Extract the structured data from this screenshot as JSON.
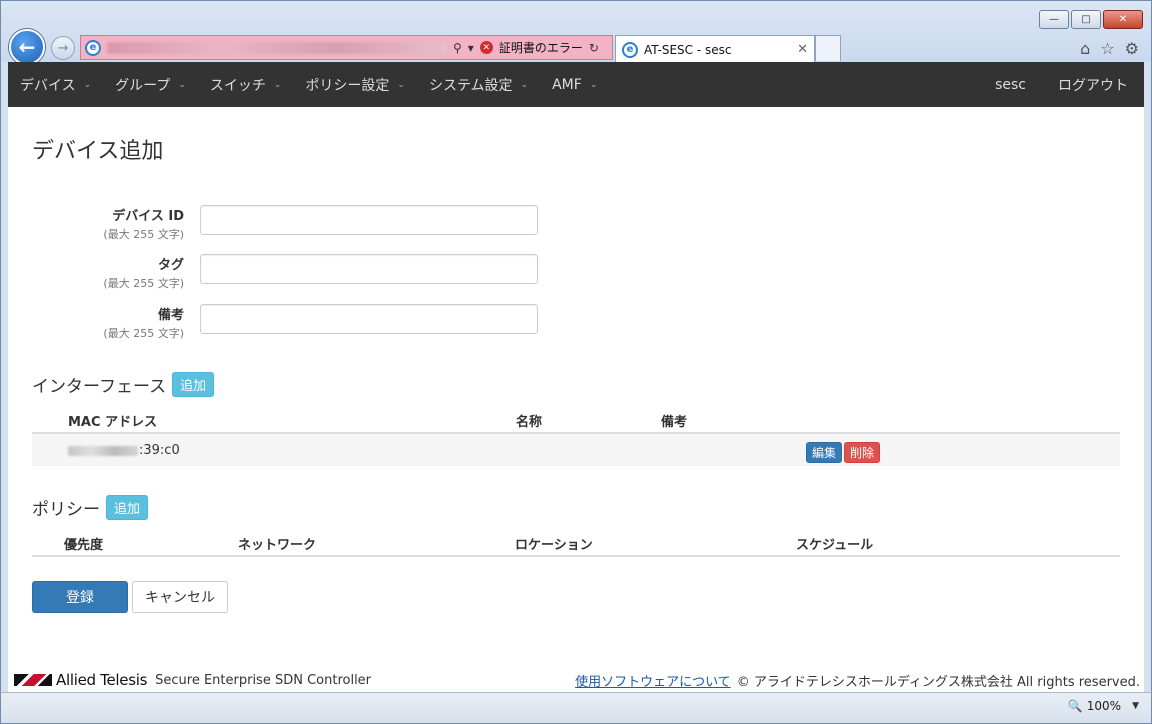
{
  "browser": {
    "tab_title": "AT-SESC - sesc",
    "cert_error": "証明書のエラー",
    "zoom": "100%"
  },
  "nav": {
    "items": [
      {
        "label": "デバイス"
      },
      {
        "label": "グループ"
      },
      {
        "label": "スイッチ"
      },
      {
        "label": "ポリシー設定"
      },
      {
        "label": "システム設定"
      },
      {
        "label": "AMF"
      }
    ],
    "user": "sesc",
    "logout": "ログアウト"
  },
  "page": {
    "title": "デバイス追加"
  },
  "form": {
    "device_id": {
      "label": "デバイス ID",
      "hint": "(最大 255 文字)",
      "value": ""
    },
    "tag": {
      "label": "タグ",
      "hint": "(最大 255 文字)",
      "value": ""
    },
    "note": {
      "label": "備考",
      "hint": "(最大 255 文字)",
      "value": ""
    }
  },
  "interfaces": {
    "title": "インターフェース",
    "add_label": "追加",
    "columns": {
      "mac": "MAC アドレス",
      "name": "名称",
      "note": "備考"
    },
    "rows": [
      {
        "mac_suffix": ":39:c0",
        "edit": "編集",
        "delete": "削除"
      }
    ]
  },
  "policies": {
    "title": "ポリシー",
    "add_label": "追加",
    "columns": {
      "priority": "優先度",
      "network": "ネットワーク",
      "location": "ロケーション",
      "schedule": "スケジュール"
    }
  },
  "actions": {
    "submit": "登録",
    "cancel": "キャンセル"
  },
  "footer": {
    "brand": "Allied Telesis",
    "product": "Secure Enterprise SDN Controller",
    "software_link": "使用ソフトウェアについて",
    "copyright": "© アライドテレシスホールディングス株式会社 All rights reserved."
  }
}
